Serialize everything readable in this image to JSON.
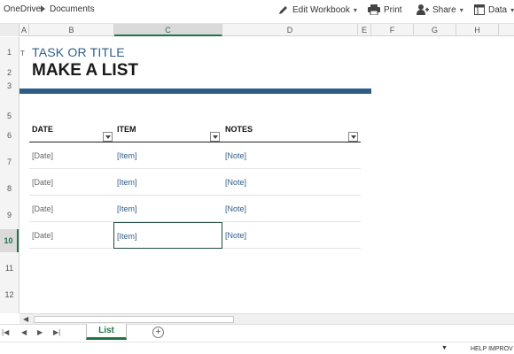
{
  "breadcrumb": {
    "root": "OneDrive",
    "folder": "Documents"
  },
  "toolbar": {
    "edit_workbook": "Edit Workbook",
    "print": "Print",
    "share": "Share",
    "data": "Data"
  },
  "columns": [
    "A",
    "B",
    "C",
    "D",
    "E",
    "F",
    "G",
    "H"
  ],
  "selected_column": "C",
  "rows": [
    "1",
    "2",
    "3",
    "5",
    "6",
    "7",
    "8",
    "9",
    "10",
    "11",
    "12"
  ],
  "selected_row": "10",
  "sheet": {
    "marker": "T",
    "task_title": "TASK OR TITLE",
    "main_title": "MAKE A LIST"
  },
  "table": {
    "headers": {
      "date": "DATE",
      "item": "ITEM",
      "notes": "NOTES"
    },
    "rows": [
      {
        "date": "[Date]",
        "item": "[Item]",
        "note": "[Note]"
      },
      {
        "date": "[Date]",
        "item": "[Item]",
        "note": "[Note]"
      },
      {
        "date": "[Date]",
        "item": "[Item]",
        "note": "[Note]"
      },
      {
        "date": "[Date]",
        "item": "[Item]",
        "note": "[Note]"
      }
    ]
  },
  "tabs": {
    "active": "List"
  },
  "status": {
    "help": "HELP IMPROV"
  },
  "colors": {
    "accent": "#2f5d8a",
    "excel_green": "#217346"
  }
}
